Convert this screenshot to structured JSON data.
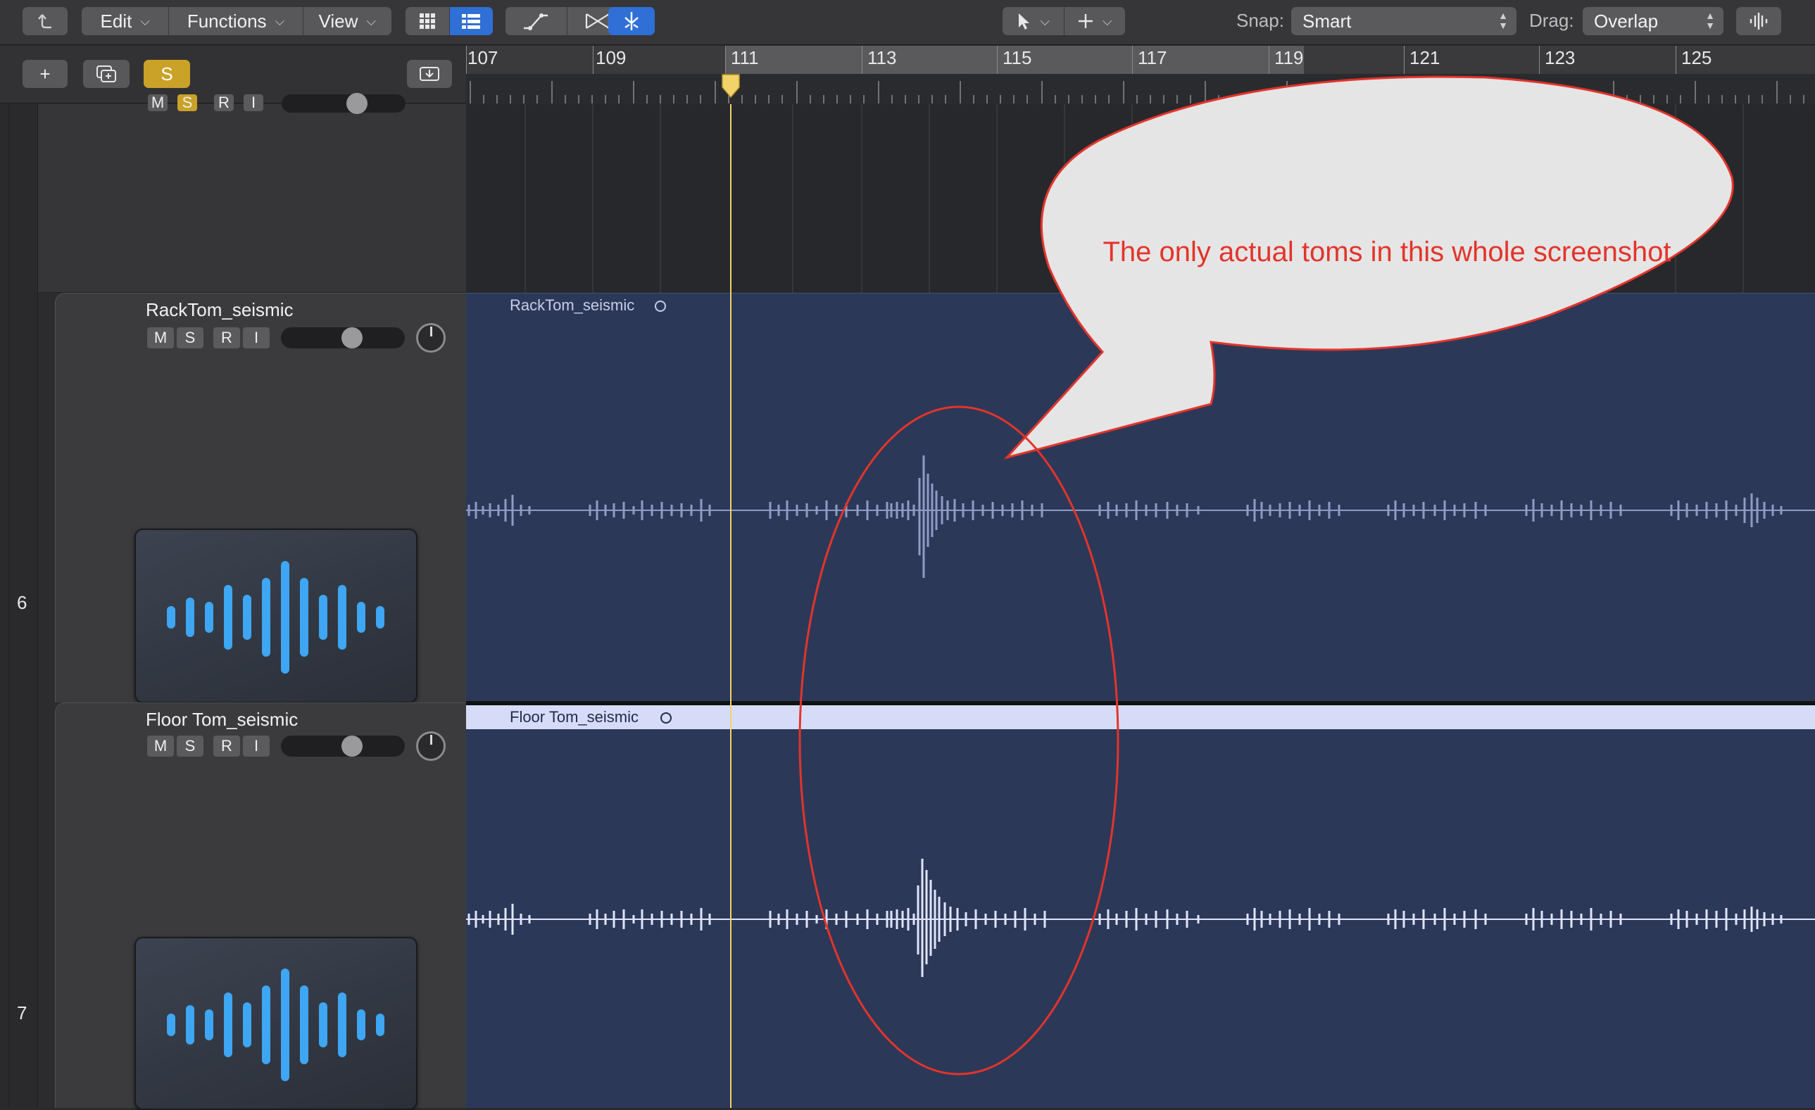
{
  "toolbar": {
    "back_icon": "up-arrow-icon",
    "menus": [
      {
        "label": "Edit"
      },
      {
        "label": "Functions"
      },
      {
        "label": "View"
      }
    ],
    "snap_label": "Snap:",
    "snap_value": "Smart",
    "drag_label": "Drag:",
    "drag_value": "Overlap"
  },
  "header": {
    "add_label": "+",
    "solo_label": "S"
  },
  "ruler": {
    "bars": [
      "107",
      "109",
      "111",
      "113",
      "115",
      "117",
      "119",
      "121",
      "123",
      "125"
    ],
    "playhead_bar": "111"
  },
  "tracks": [
    {
      "number": "",
      "name": "",
      "buttons": [
        "M",
        "S",
        "R",
        "I"
      ]
    },
    {
      "number": "6",
      "name": "RackTom_seismic",
      "buttons": [
        "M",
        "S",
        "R",
        "I"
      ],
      "region_name": "RackTom_seismic"
    },
    {
      "number": "7",
      "name": "Floor Tom_seismic",
      "buttons": [
        "M",
        "S",
        "R",
        "I"
      ],
      "region_name": "Floor Tom_seismic"
    }
  ],
  "annotation": {
    "text": "The only actual toms in this whole screenshot",
    "color": "#e3342b"
  },
  "colors": {
    "region_bg": "#2c3858",
    "waveform_track6": "#8f9bc6",
    "waveform_track7": "#dfe4fb",
    "playhead": "#f2d36a",
    "solo_accent": "#c9a227",
    "active_tool": "#2f6fd6"
  }
}
